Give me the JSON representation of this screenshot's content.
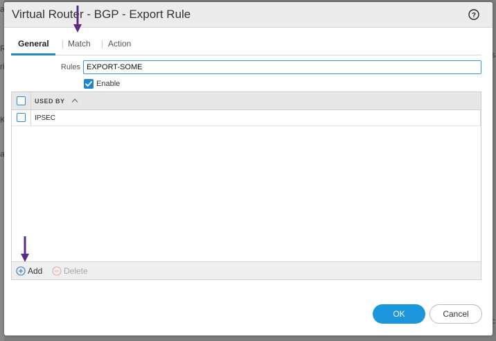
{
  "background": {
    "fragments": [
      "a",
      "R",
      "ri",
      "s",
      "K",
      "a",
      "ic"
    ]
  },
  "dialog": {
    "title": "Virtual Router - BGP - Export Rule",
    "help_icon": "question-circle-icon",
    "tabs": [
      "General",
      "Match",
      "Action"
    ],
    "active_tab": "General"
  },
  "form": {
    "rules_label": "Rules",
    "rules_value": "EXPORT-SOME",
    "enable_label": "Enable",
    "enable_checked": true
  },
  "table": {
    "column_header": "USED BY",
    "sort_icon": "chevron-up-icon",
    "rows": [
      {
        "value": "IPSEC"
      }
    ]
  },
  "footer": {
    "add_label": "Add",
    "delete_label": "Delete"
  },
  "buttons": {
    "ok_label": "OK",
    "cancel_label": "Cancel"
  },
  "colors": {
    "accent": "#1c96dc",
    "annotation_arrow": "#5b2a86"
  }
}
